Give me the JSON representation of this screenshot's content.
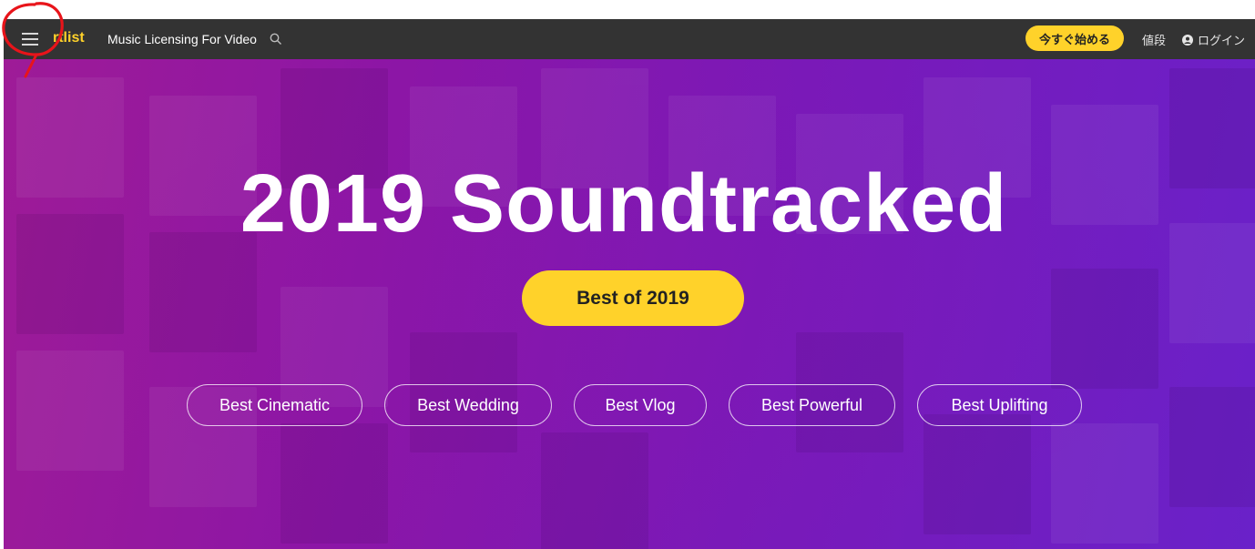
{
  "header": {
    "logo": "rtlist",
    "tagline": "Music Licensing For Video",
    "cta_label": "今すぐ始める",
    "pricing_label": "値段",
    "login_label": "ログイン",
    "icons": {
      "menu": "hamburger-menu-icon",
      "search": "search-icon",
      "user": "user-circle-icon"
    }
  },
  "hero": {
    "title": "2019 Soundtracked",
    "primary_button": "Best of 2019",
    "categories": [
      "Best Cinematic",
      "Best Wedding",
      "Best Vlog",
      "Best Powerful",
      "Best Uplifting"
    ]
  },
  "colors": {
    "navbar": "#333333",
    "accent_yellow": "#ffd22a",
    "hero_purple": "#8c16a6",
    "annotation_red": "#e8141a"
  }
}
